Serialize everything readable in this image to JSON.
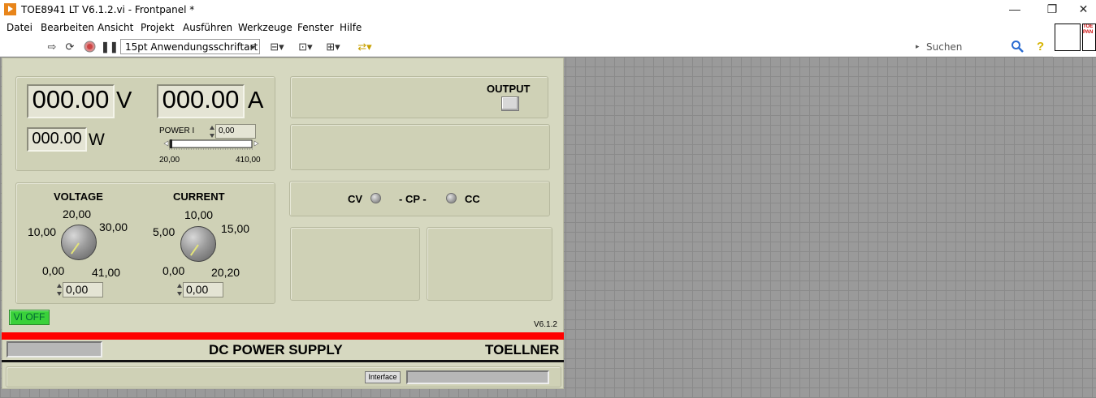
{
  "window": {
    "title": "TOE8941 LT V6.1.2.vi - Frontpanel *",
    "controls": {
      "minimize": "—",
      "maximize": "❐",
      "close": "✕"
    }
  },
  "menu": [
    "Datei",
    "Bearbeiten",
    "Ansicht",
    "Projekt",
    "Ausführen",
    "Werkzeuge",
    "Fenster",
    "Hilfe"
  ],
  "toolbar": {
    "font_select": "15pt Anwendungsschriftart",
    "search_placeholder": "Suchen",
    "icons": [
      "run-arrow-icon",
      "run-continuous-icon",
      "abort-icon",
      "pause-icon",
      "align-icon",
      "distribute-icon",
      "resize-icon",
      "reorder-icon"
    ]
  },
  "vi_icon_text": "TOE\nPAN",
  "panel": {
    "voltage_display": "000.00",
    "voltage_unit": "V",
    "current_display": "000.00",
    "current_unit": "A",
    "power_display": "000.00",
    "power_unit": "W",
    "power_limit": {
      "label": "POWER I",
      "value": "0,00",
      "slider_min": "20,00",
      "slider_max": "410,00",
      "fraction": 0.0
    },
    "output": {
      "label": "OUTPUT"
    },
    "modes": {
      "cv": "CV",
      "cp": "- CP -",
      "cc": "CC"
    },
    "voltage_knob": {
      "title": "VOLTAGE",
      "scale": [
        "0,00",
        "10,00",
        "20,00",
        "30,00",
        "41,00"
      ],
      "value": "0,00"
    },
    "current_knob": {
      "title": "CURRENT",
      "scale": [
        "0,00",
        "5,00",
        "10,00",
        "15,00",
        "20,20"
      ],
      "value": "0,00"
    },
    "vi_toggle": "VI OFF",
    "version": "V6.1.2",
    "banner_title": "DC POWER SUPPLY",
    "banner_brand": "TOELLNER",
    "interface_label": "Interface"
  },
  "colors": {
    "panel_bg": "#d6d8c0",
    "accent_red": "#ff0000",
    "vi_toggle_green": "#3ad13a"
  }
}
